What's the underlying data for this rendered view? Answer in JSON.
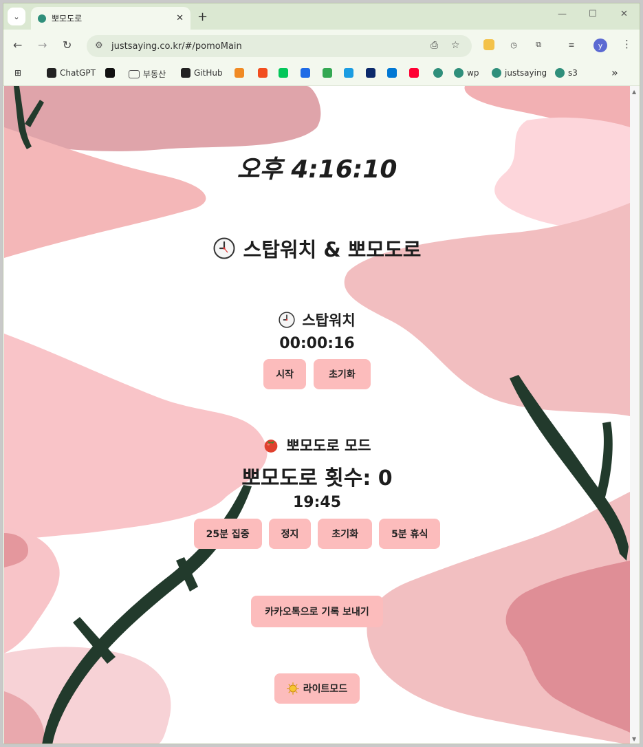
{
  "browser": {
    "tab": {
      "title": "뽀모도로"
    },
    "omnibox": {
      "url": "justsaying.co.kr/#/pomoMain"
    },
    "profile_initial": "y",
    "bookmarks": [
      {
        "label": "ChatGPT",
        "icon": "chatgpt-icon",
        "color": "#222222"
      },
      {
        "label": "",
        "icon": "ff-icon",
        "color": "#111111"
      },
      {
        "label": "부동산",
        "icon": "folder-icon",
        "color": "#555555"
      },
      {
        "label": "GitHub",
        "icon": "github-icon",
        "color": "#222222"
      },
      {
        "label": "",
        "icon": "orange-app-icon",
        "color": "#f08a24"
      },
      {
        "label": "",
        "icon": "figma-icon",
        "color": "#f24e1e"
      },
      {
        "label": "",
        "icon": "naver-icon",
        "color": "#03c75a"
      },
      {
        "label": "",
        "icon": "h-icon",
        "color": "#1e6be6"
      },
      {
        "label": "",
        "icon": "drive-icon",
        "color": "#34a853"
      },
      {
        "label": "",
        "icon": "edge-icon",
        "color": "#1b9de2"
      },
      {
        "label": "",
        "icon": "k-icon",
        "color": "#0b2a6b"
      },
      {
        "label": "",
        "icon": "vscode-icon",
        "color": "#0078d4"
      },
      {
        "label": "",
        "icon": "youtube-icon",
        "color": "#ff0033"
      },
      {
        "label": "",
        "icon": "teal-site-icon",
        "color": "#2f8f7b"
      },
      {
        "label": "wp",
        "icon": "teal-site-icon",
        "color": "#2f8f7b"
      },
      {
        "label": "justsaying",
        "icon": "teal-site-icon",
        "color": "#2f8f7b"
      },
      {
        "label": "s3",
        "icon": "teal-site-icon",
        "color": "#2f8f7b"
      }
    ],
    "more_bookmarks": "»"
  },
  "app": {
    "clock": "오후 4:16:10",
    "title": "스탑워치 & 뽀모도로",
    "stopwatch": {
      "title": "스탑워치",
      "time": "00:00:16",
      "buttons": {
        "start": "시작",
        "reset": "초기화"
      }
    },
    "pomodoro": {
      "title": "뽀모도로 모드",
      "count_label": "뽀모도로 횟수: 0",
      "time": "19:45",
      "buttons": {
        "focus": "25분 집중",
        "stop": "정지",
        "reset": "초기화",
        "rest": "5분 휴식"
      }
    },
    "kakao_button": "카카오톡으로 기록 보내기",
    "theme_button": "라이트모드",
    "colors": {
      "button_bg": "#fcbcbc",
      "blob_pink": "#f8c2c6",
      "blob_rose": "#e2959c",
      "branch": "#223a2c"
    }
  }
}
